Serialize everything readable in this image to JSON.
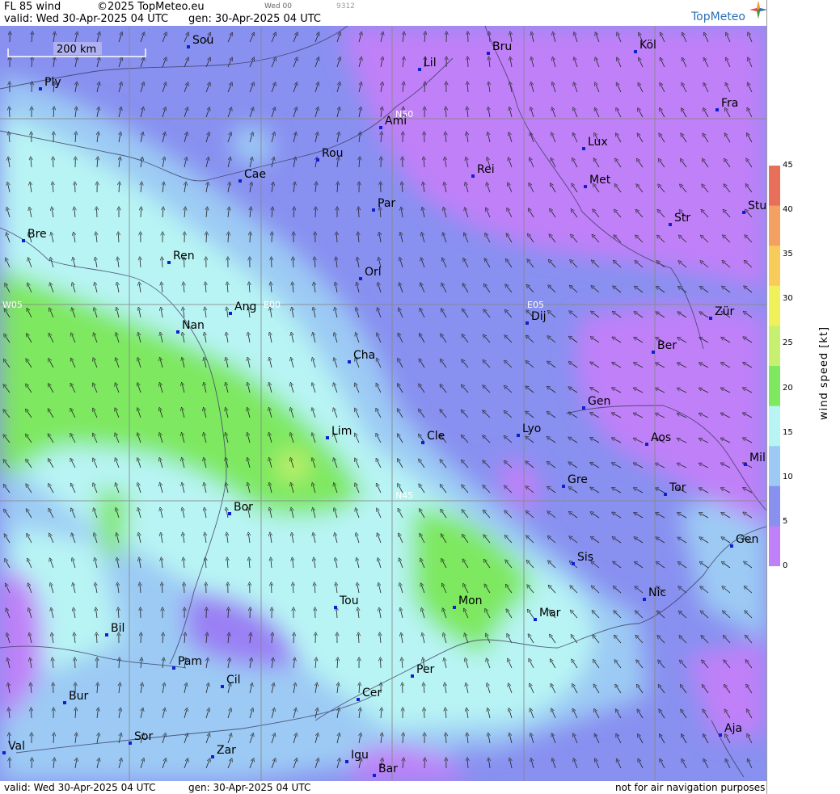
{
  "header": {
    "product": "FL 85 wind",
    "copyright": "©2025 TopMeteo.eu",
    "run_label": "Wed 00",
    "code": "9312",
    "valid": "valid:  Wed  30-Apr-2025  04 UTC",
    "gen": "gen:  30-Apr-2025  04 UTC",
    "logo": "TopMeteo"
  },
  "footer": {
    "valid": "valid:  Wed  30-Apr-2025  04 UTC",
    "gen": "gen:  30-Apr-2025  04 UTC",
    "disclaimer": "not for air navigation purposes"
  },
  "map": {
    "scale_label": "200 km",
    "grid_labels": [
      "N50",
      "N45",
      "W05",
      "E00",
      "E05"
    ],
    "cities": [
      "Sou",
      "Ply",
      "Bru",
      "Köl",
      "Lil",
      "Ami",
      "Fra",
      "Rou",
      "Cae",
      "Lux",
      "Rei",
      "Met",
      "Par",
      "Str",
      "Stu",
      "Bre",
      "Ren",
      "Orl",
      "Ang",
      "Nan",
      "Dij",
      "Zür",
      "Ber",
      "Cha",
      "Gen",
      "Lim",
      "Cle",
      "Lyo",
      "Aos",
      "Mil",
      "Gre",
      "Tor",
      "Bor",
      "Sis",
      "Gen",
      "Nic",
      "Tou",
      "Mon",
      "Mar",
      "Bil",
      "Pam",
      "Cil",
      "Per",
      "Cer",
      "Bur",
      "Sor",
      "Zar",
      "Aja",
      "Val",
      "Igu",
      "Bar"
    ]
  },
  "legend": {
    "title": "wind  speed  [kt]",
    "ticks": [
      "45",
      "40",
      "35",
      "30",
      "25",
      "20",
      "15",
      "10",
      "5",
      "0"
    ],
    "colors": [
      "#e8705a",
      "#f4a060",
      "#f8cc5a",
      "#f0f05a",
      "#c8f070",
      "#7ee860",
      "#b8f4f4",
      "#9ccaf4",
      "#8890f0",
      "#c080f8"
    ]
  }
}
